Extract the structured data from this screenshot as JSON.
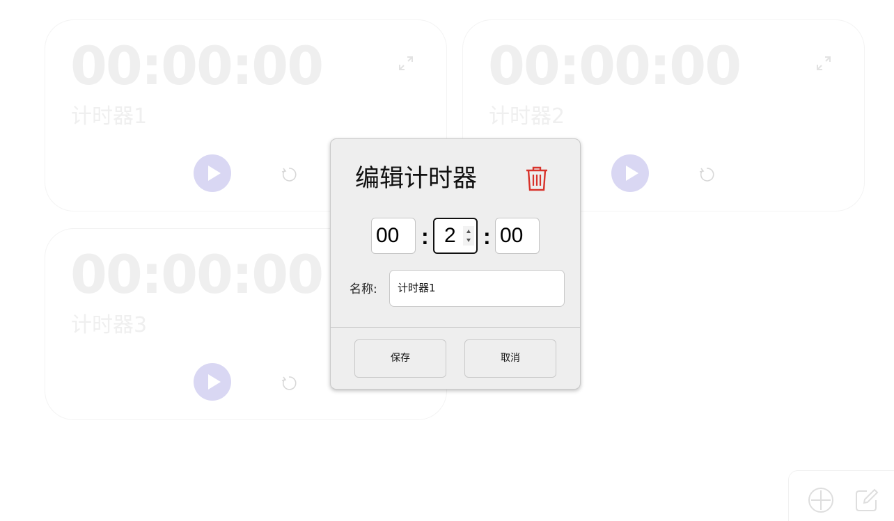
{
  "timers": [
    {
      "time": "00:00:00",
      "name": "计时器1"
    },
    {
      "time": "00:00:00",
      "name": "计时器2"
    },
    {
      "time": "00:00:00",
      "name": "计时器3"
    }
  ],
  "icons": {
    "expand": "expand-icon",
    "play": "play-icon",
    "reset": "reset-icon",
    "trash": "trash-icon",
    "add": "add-icon",
    "edit": "edit-icon"
  },
  "dialog": {
    "title": "编辑计时器",
    "hours": "00",
    "minutes": "2",
    "seconds": "00",
    "separator": ":",
    "name_label": "名称:",
    "name_value": "计时器1",
    "save_label": "保存",
    "cancel_label": "取消"
  },
  "colors": {
    "accent": "#d9d7f3",
    "danger": "#e0322a",
    "muted_text": "#efefef"
  }
}
